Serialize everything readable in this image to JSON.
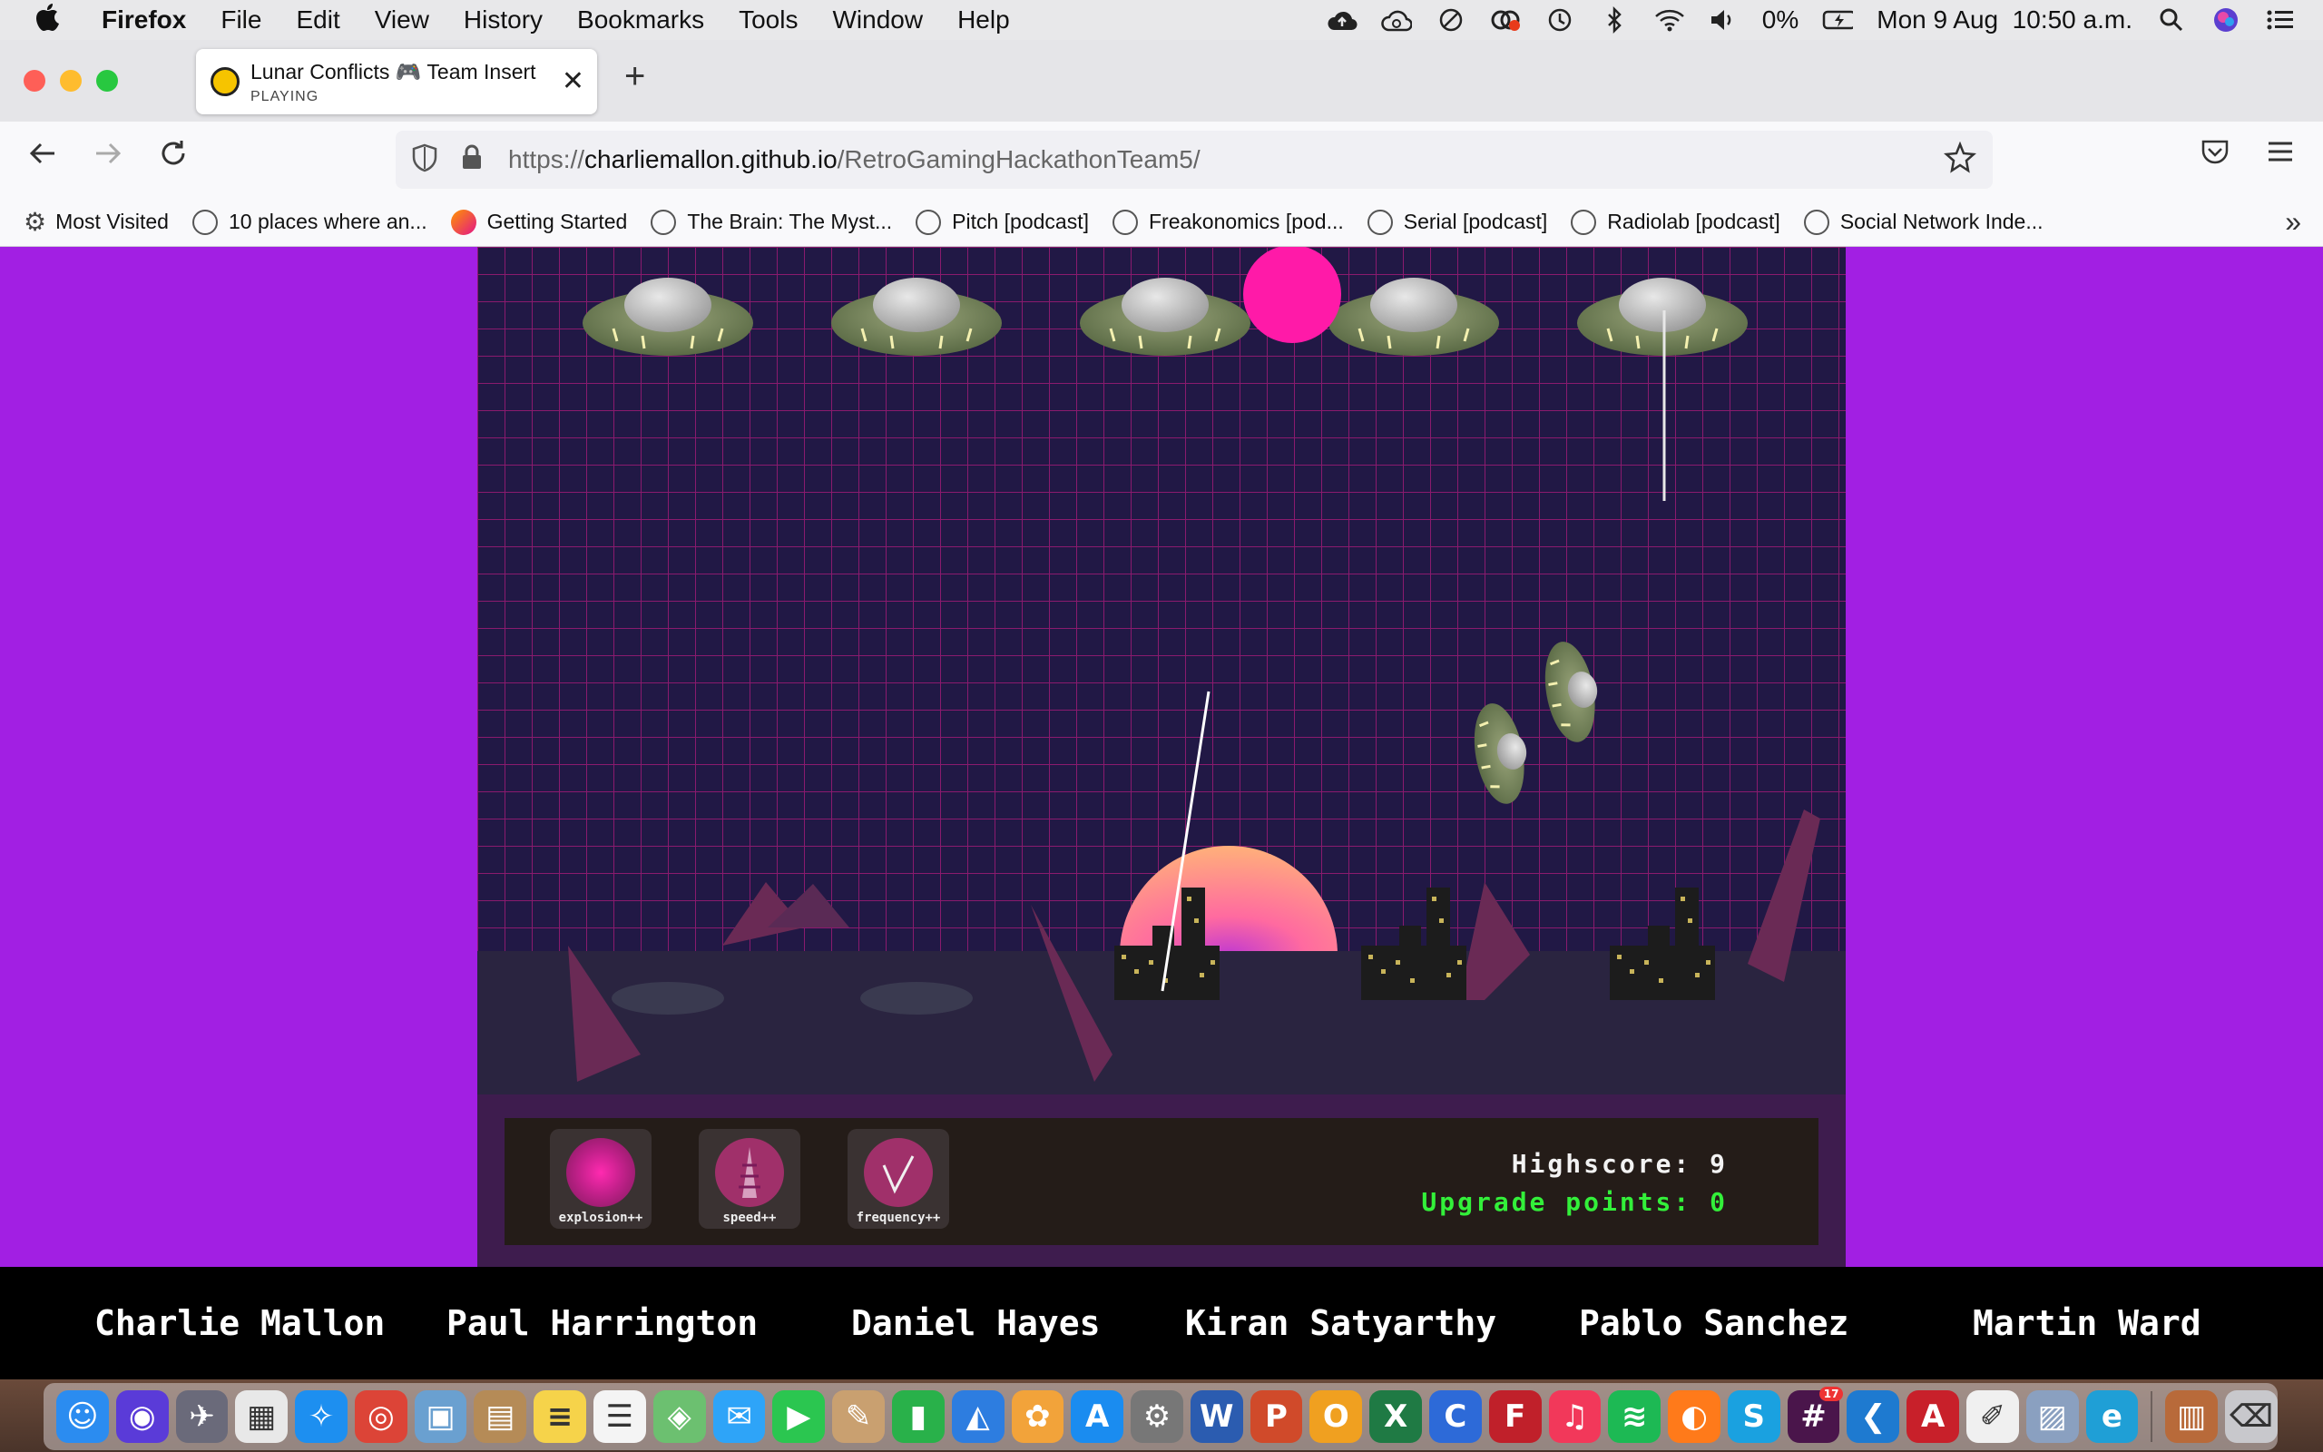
{
  "menubar": {
    "app": "Firefox",
    "items": [
      "File",
      "Edit",
      "View",
      "History",
      "Bookmarks",
      "Tools",
      "Window",
      "Help"
    ],
    "battery": "0%",
    "datetime": "Mon 9 Aug  10:50 a.m."
  },
  "tab": {
    "title": "Lunar Conflicts 🎮 Team Insert C",
    "status": "PLAYING",
    "close": "✕",
    "new_tab": "+"
  },
  "nav": {
    "url_prefix": "https://",
    "url_host": "charliemallon.github.io",
    "url_path": "/RetroGamingHackathonTeam5/"
  },
  "bookmarks": [
    {
      "label": "Most Visited",
      "icon": "gear-icon"
    },
    {
      "label": "10 places where an...",
      "icon": "globe-icon"
    },
    {
      "label": "Getting Started",
      "icon": "firefox-icon"
    },
    {
      "label": "The Brain: The Myst...",
      "icon": "globe-icon"
    },
    {
      "label": "Pitch [podcast]",
      "icon": "globe-icon"
    },
    {
      "label": "Freakonomics [pod...",
      "icon": "globe-icon"
    },
    {
      "label": "Serial [podcast]",
      "icon": "globe-icon"
    },
    {
      "label": "Radiolab [podcast]",
      "icon": "globe-icon"
    },
    {
      "label": "Social Network Inde...",
      "icon": "globe-icon"
    }
  ],
  "game": {
    "colors": {
      "background": "#211845",
      "grid": "#8a1a6e",
      "sun": "#ff8a78",
      "hud": "#241c18",
      "page": "#a21fe3"
    },
    "upgrades": [
      {
        "label": "explosion++",
        "icon": "explosion-icon"
      },
      {
        "label": "speed++",
        "icon": "speed-icon"
      },
      {
        "label": "frequency++",
        "icon": "frequency-icon"
      }
    ],
    "highscore_label": "Highscore:",
    "highscore": "9",
    "upgrade_points_label": "Upgrade points:",
    "upgrade_points": "0"
  },
  "credits": [
    "Charlie Mallon",
    "Paul Harrington",
    "Daniel Hayes",
    "Kiran Satyarthy",
    "Pablo Sanchez",
    "Martin Ward"
  ],
  "dock": {
    "apps": [
      {
        "name": "finder",
        "glyph": "☺",
        "color": "#2b8cf0"
      },
      {
        "name": "siri",
        "glyph": "◉",
        "color": "#5a3bd8"
      },
      {
        "name": "launchpad",
        "glyph": "✈",
        "color": "#6a6a7a"
      },
      {
        "name": "apps-grid",
        "glyph": "▦",
        "color": "#e8e8e8"
      },
      {
        "name": "safari",
        "glyph": "✧",
        "color": "#1d8ff0"
      },
      {
        "name": "chrome",
        "glyph": "◎",
        "color": "#dc4437"
      },
      {
        "name": "preview",
        "glyph": "▣",
        "color": "#6aa0d0"
      },
      {
        "name": "contacts",
        "glyph": "▤",
        "color": "#b58b57"
      },
      {
        "name": "notes",
        "glyph": "≡",
        "color": "#f6d34a"
      },
      {
        "name": "reminders",
        "glyph": "☰",
        "color": "#f4f4f4"
      },
      {
        "name": "maps",
        "glyph": "◈",
        "color": "#6cc070"
      },
      {
        "name": "messages",
        "glyph": "✉",
        "color": "#2ea4f8"
      },
      {
        "name": "facetime",
        "glyph": "▶",
        "color": "#2bc650"
      },
      {
        "name": "script-editor",
        "glyph": "✎",
        "color": "#c9a070"
      },
      {
        "name": "numbers",
        "glyph": "▮",
        "color": "#29b14a"
      },
      {
        "name": "keynote",
        "glyph": "◭",
        "color": "#2d7de0"
      },
      {
        "name": "photos",
        "glyph": "✿",
        "color": "#f2a33a"
      },
      {
        "name": "app-store",
        "glyph": "A",
        "color": "#1a8cf0"
      },
      {
        "name": "system-preferences",
        "glyph": "⚙",
        "color": "#777"
      },
      {
        "name": "word",
        "glyph": "W",
        "color": "#2b5cb0"
      },
      {
        "name": "powerpoint",
        "glyph": "P",
        "color": "#d04a2a"
      },
      {
        "name": "outlook",
        "glyph": "O",
        "color": "#f0a020"
      },
      {
        "name": "excel",
        "glyph": "X",
        "color": "#1f7a44"
      },
      {
        "name": "c-app",
        "glyph": "C",
        "color": "#2d6ad8"
      },
      {
        "name": "filezilla",
        "glyph": "F",
        "color": "#c0202a"
      },
      {
        "name": "music",
        "glyph": "♫",
        "color": "#f2385a"
      },
      {
        "name": "spotify",
        "glyph": "≋",
        "color": "#1db954"
      },
      {
        "name": "firefox",
        "glyph": "◐",
        "color": "#ff7a1a"
      },
      {
        "name": "skype",
        "glyph": "S",
        "color": "#1aa1e0"
      },
      {
        "name": "slack",
        "glyph": "#",
        "color": "#4a154b",
        "badge": "17"
      },
      {
        "name": "vscode",
        "glyph": "❮",
        "color": "#1e7ad0"
      },
      {
        "name": "acrobat",
        "glyph": "A",
        "color": "#c8202a"
      },
      {
        "name": "textedit",
        "glyph": "✐",
        "color": "#f0f0f0"
      },
      {
        "name": "image-viewer",
        "glyph": "▨",
        "color": "#8aa0c0"
      },
      {
        "name": "edge",
        "glyph": "e",
        "color": "#1f9fd6"
      },
      {
        "name": "downloads",
        "glyph": "▥",
        "color": "#b86a3a"
      },
      {
        "name": "trash",
        "glyph": "⌫",
        "color": "#c8c8cc"
      }
    ]
  }
}
